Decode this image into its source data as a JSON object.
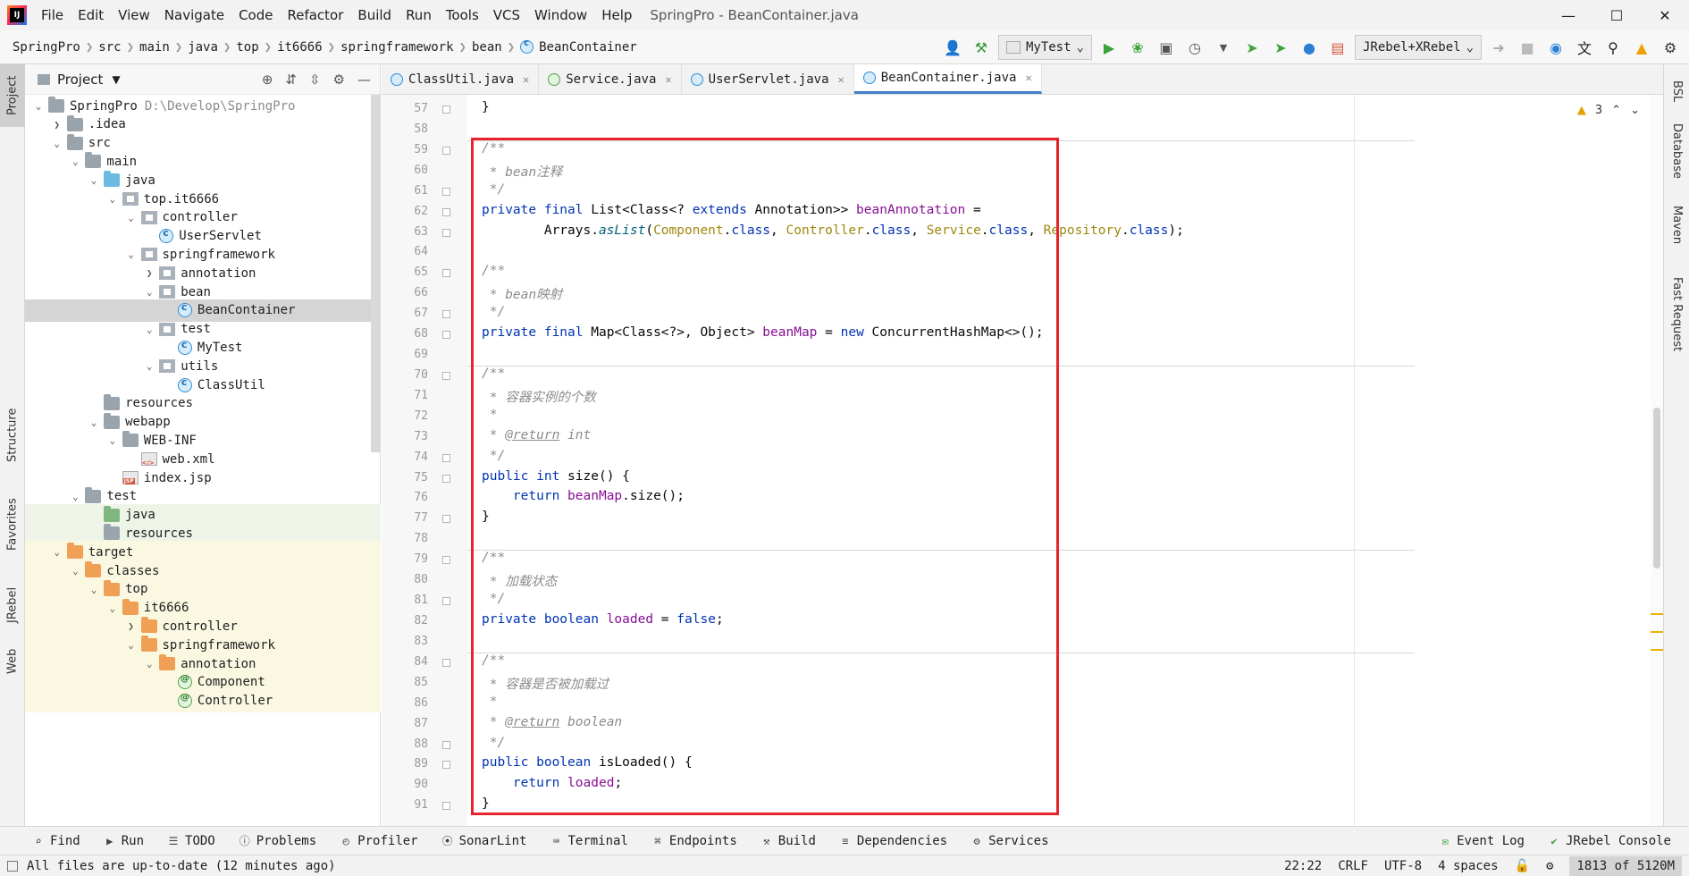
{
  "app": {
    "window_title": "SpringPro - BeanContainer.java",
    "menu": [
      "File",
      "Edit",
      "View",
      "Navigate",
      "Code",
      "Refactor",
      "Build",
      "Run",
      "Tools",
      "VCS",
      "Window",
      "Help"
    ]
  },
  "breadcrumb": [
    "SpringPro",
    "src",
    "main",
    "java",
    "top",
    "it6666",
    "springframework",
    "bean",
    "BeanContainer"
  ],
  "toolbar": {
    "run_config": "MyTest",
    "jrebel_config": "JRebel+XRebel"
  },
  "left_strip": {
    "project": "Project",
    "structure": "Structure",
    "favorites": "Favorites",
    "jrebel": "JRebel",
    "web": "Web"
  },
  "project_panel": {
    "title": "Project",
    "tree": [
      {
        "label": "SpringPro",
        "hint": "D:\\Develop\\SpringPro",
        "indent": 0,
        "arrow": "down",
        "icon": "folder"
      },
      {
        "label": ".idea",
        "indent": 1,
        "arrow": "right",
        "icon": "folder"
      },
      {
        "label": "src",
        "indent": 1,
        "arrow": "down",
        "icon": "folder"
      },
      {
        "label": "main",
        "indent": 2,
        "arrow": "down",
        "icon": "folder"
      },
      {
        "label": "java",
        "indent": 3,
        "arrow": "down",
        "icon": "folder-blue"
      },
      {
        "label": "top.it6666",
        "indent": 4,
        "arrow": "down",
        "icon": "pkg"
      },
      {
        "label": "controller",
        "indent": 5,
        "arrow": "down",
        "icon": "pkg"
      },
      {
        "label": "UserServlet",
        "indent": 6,
        "arrow": "",
        "icon": "cls"
      },
      {
        "label": "springframework",
        "indent": 5,
        "arrow": "down",
        "icon": "pkg"
      },
      {
        "label": "annotation",
        "indent": 6,
        "arrow": "right",
        "icon": "pkg"
      },
      {
        "label": "bean",
        "indent": 6,
        "arrow": "down",
        "icon": "pkg"
      },
      {
        "label": "BeanContainer",
        "indent": 7,
        "arrow": "",
        "icon": "cls",
        "selected": true
      },
      {
        "label": "test",
        "indent": 6,
        "arrow": "down",
        "icon": "pkg"
      },
      {
        "label": "MyTest",
        "indent": 7,
        "arrow": "",
        "icon": "cls"
      },
      {
        "label": "utils",
        "indent": 6,
        "arrow": "down",
        "icon": "pkg"
      },
      {
        "label": "ClassUtil",
        "indent": 7,
        "arrow": "",
        "icon": "cls"
      },
      {
        "label": "resources",
        "indent": 3,
        "arrow": "",
        "icon": "folder"
      },
      {
        "label": "webapp",
        "indent": 3,
        "arrow": "down",
        "icon": "folder"
      },
      {
        "label": "WEB-INF",
        "indent": 4,
        "arrow": "down",
        "icon": "folder"
      },
      {
        "label": "web.xml",
        "indent": 5,
        "arrow": "",
        "icon": "xml"
      },
      {
        "label": "index.jsp",
        "indent": 4,
        "arrow": "",
        "icon": "jsp"
      },
      {
        "label": "test",
        "indent": 2,
        "arrow": "down",
        "icon": "folder"
      },
      {
        "label": "java",
        "indent": 3,
        "arrow": "",
        "icon": "folder-green",
        "bg": "green"
      },
      {
        "label": "resources",
        "indent": 3,
        "arrow": "",
        "icon": "folder",
        "bg": "green"
      },
      {
        "label": "target",
        "indent": 1,
        "arrow": "down",
        "icon": "folder-orange",
        "bg": "yellow"
      },
      {
        "label": "classes",
        "indent": 2,
        "arrow": "down",
        "icon": "folder-orange",
        "bg": "yellow"
      },
      {
        "label": "top",
        "indent": 3,
        "arrow": "down",
        "icon": "folder-orange",
        "bg": "yellow"
      },
      {
        "label": "it6666",
        "indent": 4,
        "arrow": "down",
        "icon": "folder-orange",
        "bg": "yellow"
      },
      {
        "label": "controller",
        "indent": 5,
        "arrow": "right",
        "icon": "folder-orange",
        "bg": "yellow"
      },
      {
        "label": "springframework",
        "indent": 5,
        "arrow": "down",
        "icon": "folder-orange",
        "bg": "yellow"
      },
      {
        "label": "annotation",
        "indent": 6,
        "arrow": "down",
        "icon": "folder-orange",
        "bg": "yellow"
      },
      {
        "label": "Component",
        "indent": 7,
        "arrow": "",
        "icon": "anno",
        "bg": "yellow"
      },
      {
        "label": "Controller",
        "indent": 7,
        "arrow": "",
        "icon": "anno",
        "bg": "yellow"
      }
    ]
  },
  "editor_tabs": [
    {
      "label": "ClassUtil.java",
      "icon": "cls",
      "active": false
    },
    {
      "label": "Service.java",
      "icon": "anno",
      "active": false
    },
    {
      "label": "UserServlet.java",
      "icon": "cls",
      "active": false
    },
    {
      "label": "BeanContainer.java",
      "icon": "cls",
      "active": true
    }
  ],
  "editor": {
    "warning_count": "3",
    "lines": [
      {
        "n": "57",
        "html": "}"
      },
      {
        "n": "58",
        "html": ""
      },
      {
        "n": "59",
        "html": "<span class=\"c\">/**</span>"
      },
      {
        "n": "60",
        "html": "<span class=\"c\"> * bean注释</span>"
      },
      {
        "n": "61",
        "html": "<span class=\"c\"> */</span>"
      },
      {
        "n": "62",
        "html": "<span class=\"k\">private final</span> List&lt;Class&lt;? <span class=\"k\">extends</span> Annotation&gt;&gt; <span class=\"f\">beanAnnotation</span> ="
      },
      {
        "n": "63",
        "html": "        Arrays.<span class=\"m\">asList</span>(<span class=\"s\">Component</span>.<span class=\"k\">class</span>, <span class=\"s\">Controller</span>.<span class=\"k\">class</span>, <span class=\"s\">Service</span>.<span class=\"k\">class</span>, <span class=\"s\">Repository</span>.<span class=\"k\">class</span>);"
      },
      {
        "n": "64",
        "html": ""
      },
      {
        "n": "65",
        "html": "<span class=\"c\">/**</span>"
      },
      {
        "n": "66",
        "html": "<span class=\"c\"> * bean映射</span>"
      },
      {
        "n": "67",
        "html": "<span class=\"c\"> */</span>"
      },
      {
        "n": "68",
        "html": "<span class=\"k\">private final</span> Map&lt;Class&lt;?&gt;, Object&gt; <span class=\"f\">beanMap</span> = <span class=\"k\">new</span> ConcurrentHashMap&lt;&gt;();"
      },
      {
        "n": "69",
        "html": ""
      },
      {
        "n": "70",
        "html": "<span class=\"c\">/**</span>"
      },
      {
        "n": "71",
        "html": "<span class=\"c\"> * 容器实例的个数</span>"
      },
      {
        "n": "72",
        "html": "<span class=\"c\"> *</span>"
      },
      {
        "n": "73",
        "html": "<span class=\"c\"> * </span><span class=\"tag\">@return</span><span class=\"c\"> int</span>"
      },
      {
        "n": "74",
        "html": "<span class=\"c\"> */</span>"
      },
      {
        "n": "75",
        "html": "<span class=\"k\">public int</span> size() {"
      },
      {
        "n": "76",
        "html": "    <span class=\"k\">return</span> <span class=\"f\">beanMap</span>.size();"
      },
      {
        "n": "77",
        "html": "}"
      },
      {
        "n": "78",
        "html": ""
      },
      {
        "n": "79",
        "html": "<span class=\"c\">/**</span>"
      },
      {
        "n": "80",
        "html": "<span class=\"c\"> * 加载状态</span>"
      },
      {
        "n": "81",
        "html": "<span class=\"c\"> */</span>"
      },
      {
        "n": "82",
        "html": "<span class=\"k\">private boolean</span> <span class=\"f\">loaded</span> = <span class=\"k\">false</span>;"
      },
      {
        "n": "83",
        "html": ""
      },
      {
        "n": "84",
        "html": "<span class=\"c\">/**</span>"
      },
      {
        "n": "85",
        "html": "<span class=\"c\"> * 容器是否被加载过</span>"
      },
      {
        "n": "86",
        "html": "<span class=\"c\"> *</span>"
      },
      {
        "n": "87",
        "html": "<span class=\"c\"> * </span><span class=\"tag\">@return</span><span class=\"c\"> boolean</span>"
      },
      {
        "n": "88",
        "html": "<span class=\"c\"> */</span>"
      },
      {
        "n": "89",
        "html": "<span class=\"k\">public boolean</span> isLoaded() {"
      },
      {
        "n": "90",
        "html": "    <span class=\"k\">return</span> <span class=\"f\">loaded</span>;"
      },
      {
        "n": "91",
        "html": "}"
      }
    ]
  },
  "right_strip": [
    "BSL",
    "Database",
    "Maven",
    "Fast Request"
  ],
  "bottom_tools": [
    "Find",
    "Run",
    "TODO",
    "Problems",
    "Profiler",
    "SonarLint",
    "Terminal",
    "Endpoints",
    "Build",
    "Dependencies",
    "Services"
  ],
  "bottom_right_tools": [
    "Event Log",
    "JRebel Console"
  ],
  "status": {
    "message": "All files are up-to-date (12 minutes ago)",
    "position": "22:22",
    "line_sep": "CRLF",
    "encoding": "UTF-8",
    "indent": "4 spaces",
    "memory": "1813 of 5120M"
  }
}
